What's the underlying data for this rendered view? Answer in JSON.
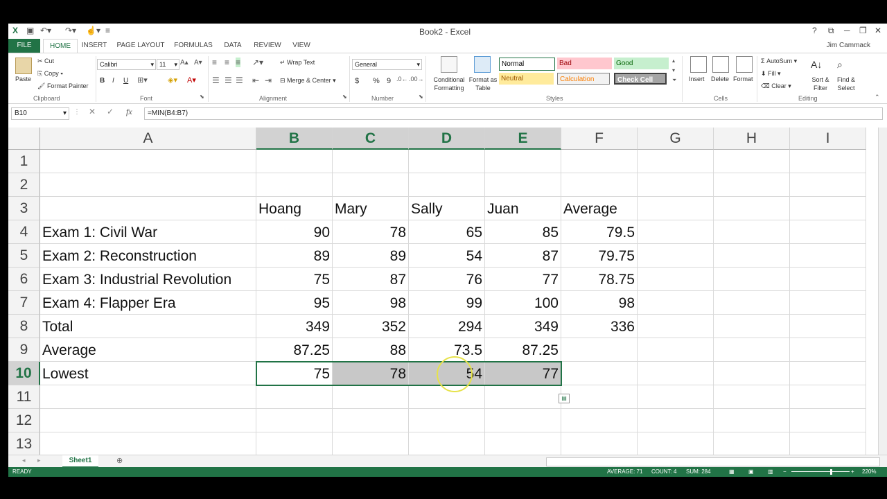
{
  "window": {
    "title": "Book2 - Excel",
    "user": "Jim Cammack",
    "help": "?",
    "minimize": "─",
    "restore": "❐",
    "close": "✕"
  },
  "ribbon_tabs": [
    "FILE",
    "HOME",
    "INSERT",
    "PAGE LAYOUT",
    "FORMULAS",
    "DATA",
    "REVIEW",
    "VIEW"
  ],
  "clipboard": {
    "paste": "Paste",
    "cut": "Cut",
    "copy": "Copy",
    "format_painter": "Format Painter",
    "group": "Clipboard"
  },
  "font": {
    "name": "Calibri",
    "size": "11",
    "bold": "B",
    "italic": "I",
    "underline": "U",
    "group": "Font"
  },
  "alignment": {
    "wrap": "Wrap Text",
    "merge": "Merge & Center",
    "group": "Alignment"
  },
  "number": {
    "format": "General",
    "currency": "$",
    "percent": "%",
    "comma": "9",
    "group": "Number"
  },
  "styles": {
    "conditional": "Conditional Formatting",
    "format_table": "Format as Table",
    "normal": "Normal",
    "bad": "Bad",
    "good": "Good",
    "neutral": "Neutral",
    "calculation": "Calculation",
    "check_cell": "Check Cell",
    "group": "Styles",
    "colors": {
      "normal_bg": "#ffffff",
      "bad_bg": "#ffc7ce",
      "bad_fg": "#9c0006",
      "good_bg": "#c6efce",
      "good_fg": "#006100",
      "neutral_bg": "#ffeb9c",
      "neutral_fg": "#9c5700",
      "calc_bg": "#f2f2f2",
      "calc_fg": "#fa7d00",
      "check_bg": "#a5a5a5",
      "check_fg": "#ffffff"
    }
  },
  "cells_group": {
    "insert": "Insert",
    "delete": "Delete",
    "format": "Format",
    "group": "Cells"
  },
  "editing": {
    "autosum": "AutoSum",
    "fill": "Fill",
    "clear": "Clear",
    "sort": "Sort & Filter",
    "find": "Find & Select",
    "group": "Editing"
  },
  "formula_bar": {
    "name_box": "B10",
    "formula": "=MIN(B4:B7)",
    "fx": "fx"
  },
  "columns": [
    "A",
    "B",
    "C",
    "D",
    "E",
    "F",
    "G",
    "H",
    "I"
  ],
  "rows": [
    "1",
    "2",
    "3",
    "4",
    "5",
    "6",
    "7",
    "8",
    "9",
    "10",
    "11",
    "12",
    "13"
  ],
  "sheet": {
    "r3": [
      "",
      "Hoang",
      "Mary",
      "Sally",
      "Juan",
      "Average"
    ],
    "r4": [
      "Exam 1:  Civil War",
      "90",
      "78",
      "65",
      "85",
      "79.5"
    ],
    "r5": [
      "Exam 2:  Reconstruction",
      "89",
      "89",
      "54",
      "87",
      "79.75"
    ],
    "r6": [
      "Exam 3: Industrial Revolution",
      "75",
      "87",
      "76",
      "77",
      "78.75"
    ],
    "r7": [
      "Exam 4: Flapper Era",
      "95",
      "98",
      "99",
      "100",
      "98"
    ],
    "r8": [
      "Total",
      "349",
      "352",
      "294",
      "349",
      "336"
    ],
    "r9": [
      "Average",
      "87.25",
      "88",
      "73.5",
      "87.25",
      ""
    ],
    "r10": [
      "Lowest",
      "75",
      "78",
      "54",
      "77",
      ""
    ]
  },
  "sheet_tab": "Sheet1",
  "status": {
    "ready": "READY",
    "average": "AVERAGE: 71",
    "count": "COUNT: 4",
    "sum": "SUM: 284",
    "zoom": "220%"
  },
  "accent": "#217346"
}
